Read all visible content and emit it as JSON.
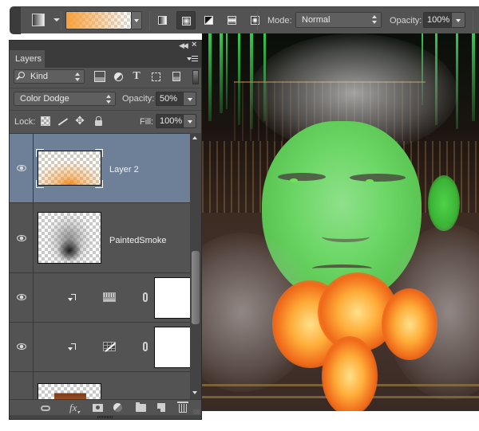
{
  "options_bar": {
    "tool_preset_icon": "gradient-tool-preset-icon",
    "gradient_swatch": {
      "start_color": "#f7a03a",
      "end": "transparent"
    },
    "gradient_types": [
      {
        "name": "linear",
        "active": false
      },
      {
        "name": "radial",
        "active": true
      },
      {
        "name": "angle",
        "active": false
      },
      {
        "name": "reflected",
        "active": false
      },
      {
        "name": "diamond",
        "active": false
      }
    ],
    "mode_label": "Mode:",
    "mode_value": "Normal",
    "opacity_label": "Opacity:",
    "opacity_value": "100%"
  },
  "layers_panel": {
    "tab_label": "Layers",
    "filter": {
      "kind_label": "Kind",
      "icons": [
        "pixel-filter-icon",
        "adjustment-filter-icon",
        "type-filter-icon",
        "shape-filter-icon",
        "smart-object-filter-icon"
      ]
    },
    "blend_mode": "Color Dodge",
    "opacity_label": "Opacity:",
    "opacity_value": "50%",
    "lock_label": "Lock:",
    "fill_label": "Fill:",
    "fill_value": "100%",
    "layers": [
      {
        "name": "Layer 2",
        "type": "pixel",
        "selected": true,
        "visible": true
      },
      {
        "name": "PaintedSmoke",
        "type": "pixel",
        "selected": false,
        "visible": true
      },
      {
        "name": "",
        "type": "levels-adjustment",
        "clipped": true,
        "visible": true
      },
      {
        "name": "",
        "type": "curves-adjustment",
        "clipped": true,
        "visible": true
      },
      {
        "name": "",
        "type": "pixel-building",
        "selected": false,
        "visible": false
      }
    ],
    "bottom_icons": [
      "link-layers-icon",
      "fx-icon",
      "add-mask-icon",
      "new-adjustment-icon",
      "new-group-icon",
      "new-layer-icon",
      "delete-icon"
    ]
  },
  "colors": {
    "panel_bg": "#535353",
    "selected_layer": "#6d8098",
    "toolbar_bg": "#535353"
  }
}
